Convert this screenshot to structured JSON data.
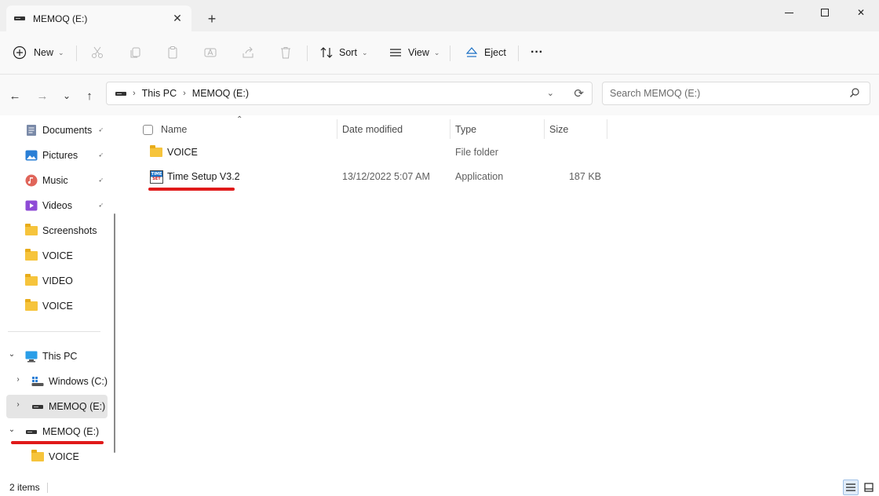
{
  "tab": {
    "title": "MEMOQ (E:)",
    "close_glyph": "✕",
    "new_tab_glyph": "+"
  },
  "window": {
    "minimize_icon": "minimize-icon",
    "maximize_icon": "maximize-icon",
    "close_glyph": "✕"
  },
  "toolbar": {
    "new_label": "New",
    "sort_label": "Sort",
    "view_label": "View",
    "eject_label": "Eject",
    "more_glyph": "···",
    "caret_glyph": "⌄"
  },
  "nav": {
    "back_glyph": "←",
    "forward_glyph": "→",
    "recent_glyph": "⌄",
    "up_glyph": "↑"
  },
  "address": {
    "crumbs": [
      "This PC",
      "MEMOQ (E:)"
    ],
    "separator": "›",
    "dropdown_glyph": "⌄",
    "refresh_glyph": "⟳"
  },
  "search": {
    "placeholder": "Search MEMOQ (E:)"
  },
  "sidebar": {
    "quick_access": [
      {
        "label": "Documents",
        "icon": "documents-icon",
        "pinned": true
      },
      {
        "label": "Pictures",
        "icon": "pictures-icon",
        "pinned": true
      },
      {
        "label": "Music",
        "icon": "music-icon",
        "pinned": true
      },
      {
        "label": "Videos",
        "icon": "videos-icon",
        "pinned": true
      },
      {
        "label": "Screenshots",
        "icon": "folder-icon",
        "pinned": false
      },
      {
        "label": "VOICE",
        "icon": "folder-icon",
        "pinned": false
      },
      {
        "label": "VIDEO",
        "icon": "folder-icon",
        "pinned": false
      },
      {
        "label": "VOICE",
        "icon": "folder-icon",
        "pinned": false
      }
    ],
    "pin_glyph": "📌",
    "this_pc": "This PC",
    "windows_c": "Windows (C:)",
    "memoq_selected": "MEMOQ (E:)",
    "memoq_expanded": "MEMOQ (E:)",
    "voice_child": "VOICE",
    "expand_glyph": "›",
    "collapse_glyph": "⌄"
  },
  "columns": {
    "name": "Name",
    "date_modified": "Date modified",
    "type": "Type",
    "size": "Size",
    "sort_glyph": "⌃"
  },
  "files": [
    {
      "name": "VOICE",
      "date": "",
      "type": "File folder",
      "size": "",
      "icon": "folder-icon"
    },
    {
      "name": "Time Setup V3.2",
      "date": "13/12/2022 5:07 AM",
      "type": "Application",
      "size": "187 KB",
      "icon": "time-set-app-icon"
    }
  ],
  "app_icon_text": {
    "top": "TIME",
    "bottom": "SET"
  },
  "status": {
    "items": "2 items"
  },
  "colors": {
    "annotation_red": "#e01a1a",
    "folder_yellow": "#f6c43c",
    "selection_gray": "#e5e5e5"
  }
}
